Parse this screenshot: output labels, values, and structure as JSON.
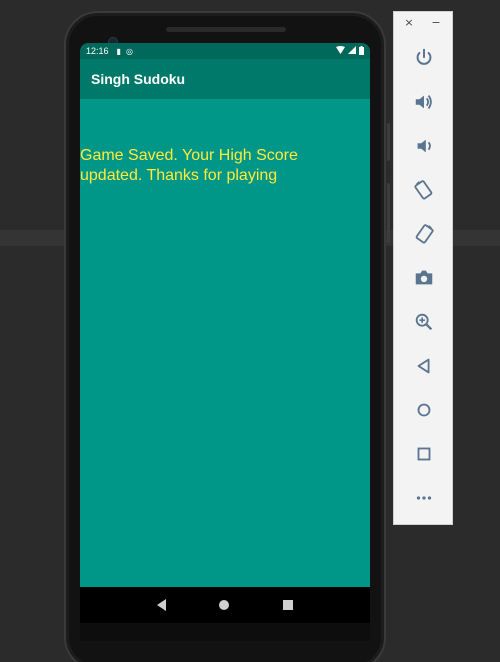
{
  "status_bar": {
    "time": "12:16"
  },
  "app": {
    "title": "Singh Sudoku",
    "message": "Game Saved. Your High Score updated. Thanks for playing"
  },
  "colors": {
    "status_bar_bg": "#00695c",
    "app_bar_bg": "#00796b",
    "content_bg": "#009688",
    "message_text": "#ffeb3b",
    "title_text": "#ffffff"
  },
  "navigation": {
    "buttons": [
      "back-icon",
      "home-icon",
      "recents-icon"
    ]
  },
  "emulator_toolbar": {
    "window_controls": {
      "close": "×",
      "minimize": "−"
    },
    "tools": [
      "power-icon",
      "volume-up-icon",
      "volume-down-icon",
      "rotate-left-icon",
      "rotate-right-icon",
      "camera-icon",
      "zoom-icon",
      "back-icon",
      "home-icon",
      "overview-icon",
      "more-icon"
    ]
  }
}
